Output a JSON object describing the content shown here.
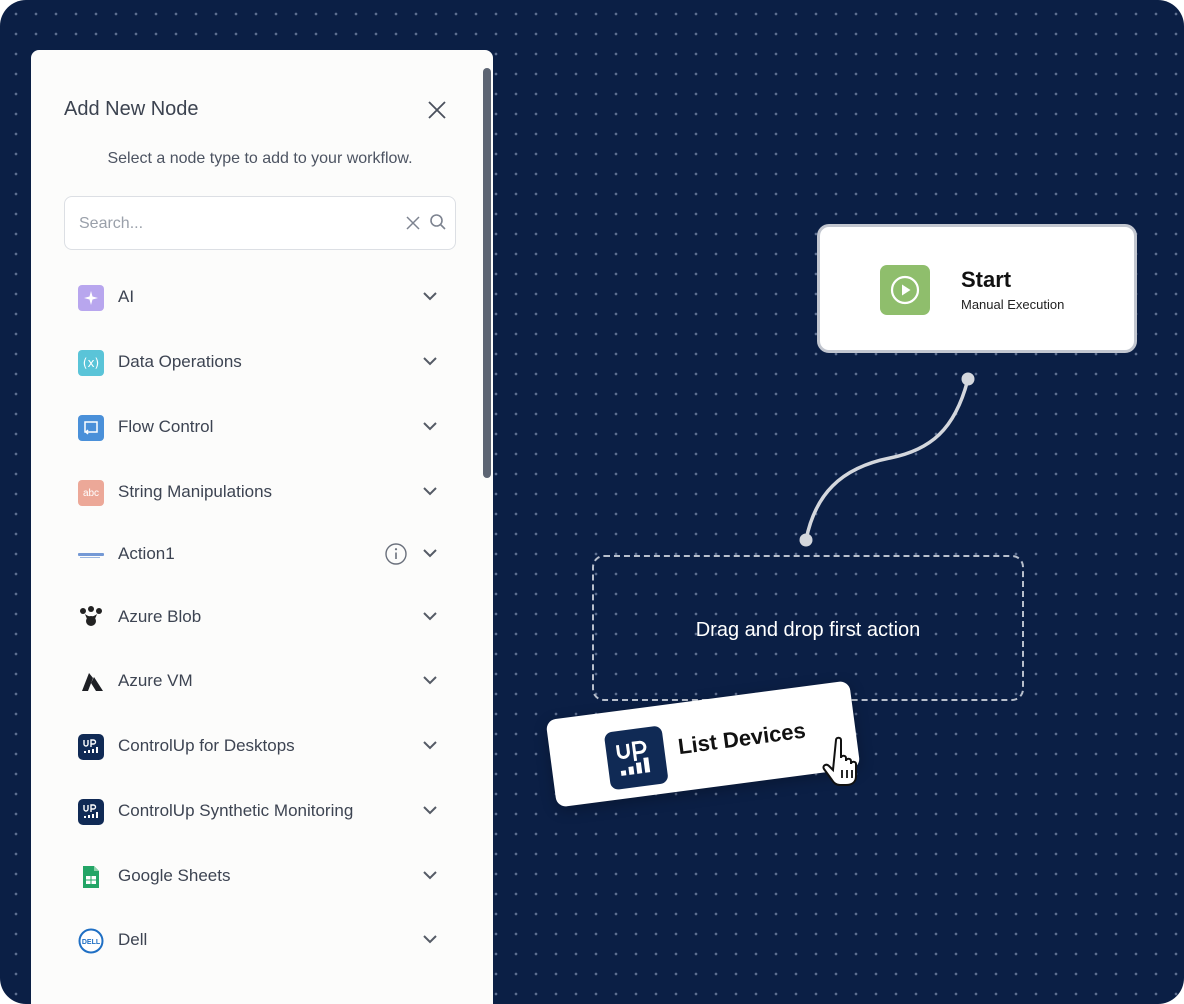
{
  "panel": {
    "title": "Add New Node",
    "subtitle": "Select a node type to add to your workflow.",
    "search": {
      "placeholder": "Search...",
      "value": ""
    },
    "items": [
      {
        "label": "AI",
        "icon": "sparkle-icon"
      },
      {
        "label": "Data Operations",
        "icon": "variable-icon"
      },
      {
        "label": "Flow Control",
        "icon": "flow-control-icon"
      },
      {
        "label": "String Manipulations",
        "icon": "abc-icon"
      },
      {
        "label": "Action1",
        "icon": "action1-logo-icon",
        "info": true
      },
      {
        "label": "Azure Blob",
        "icon": "azure-blob-icon"
      },
      {
        "label": "Azure VM",
        "icon": "azure-icon"
      },
      {
        "label": "ControlUp for Desktops",
        "icon": "controlup-icon"
      },
      {
        "label": "ControlUp Synthetic Monitoring",
        "icon": "controlup-icon"
      },
      {
        "label": "Google Sheets",
        "icon": "google-sheets-icon"
      },
      {
        "label": "Dell",
        "icon": "dell-icon"
      }
    ]
  },
  "start_node": {
    "title": "Start",
    "subtitle": "Manual Execution",
    "icon": "play-icon",
    "color": "#8fbe6c"
  },
  "drop_zone": {
    "text": "Drag and drop first action"
  },
  "drag_card": {
    "label": "List Devices",
    "icon": "controlup-icon"
  },
  "colors": {
    "canvas": "#0b1f45",
    "panel": "#fcfcfb",
    "start_accent": "#8fbe6c"
  }
}
